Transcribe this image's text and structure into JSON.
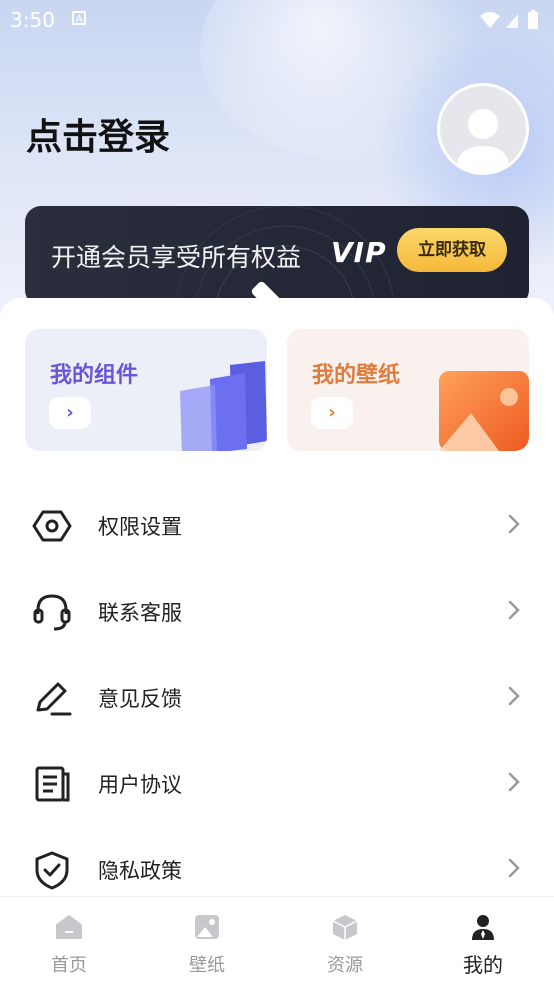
{
  "status_bar": {
    "time": "3:50",
    "app_icon": "A"
  },
  "header": {
    "login_text": "点击登录"
  },
  "vip": {
    "text": "开通会员享受所有权益",
    "badge": "VIP",
    "button_label": "立即获取"
  },
  "cards": [
    {
      "title": "我的组件",
      "arrow": "›"
    },
    {
      "title": "我的壁纸",
      "arrow": "›"
    }
  ],
  "menu": [
    {
      "label": "权限设置",
      "icon": "hexagon-settings-icon"
    },
    {
      "label": "联系客服",
      "icon": "headset-icon"
    },
    {
      "label": "意见反馈",
      "icon": "pencil-icon"
    },
    {
      "label": "用户协议",
      "icon": "document-icon"
    },
    {
      "label": "隐私政策",
      "icon": "shield-check-icon"
    }
  ],
  "tabbar": [
    {
      "label": "首页",
      "icon": "home-icon",
      "active": false
    },
    {
      "label": "壁纸",
      "icon": "image-icon",
      "active": false
    },
    {
      "label": "资源",
      "icon": "cube-icon",
      "active": false
    },
    {
      "label": "我的",
      "icon": "user-icon",
      "active": true
    }
  ],
  "colors": {
    "accent_purple": "#6a55d8",
    "accent_orange": "#e07b3c",
    "vip_gold": "#f4b93a",
    "vip_dark": "#2b2f3d"
  }
}
